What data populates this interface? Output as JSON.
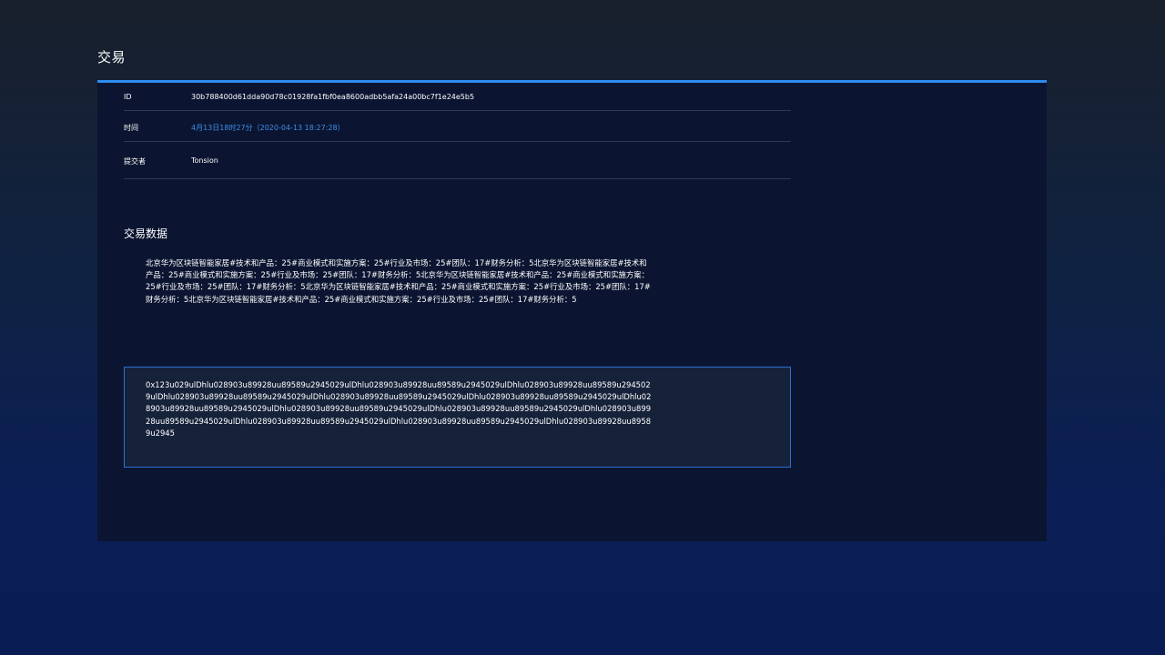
{
  "page": {
    "title": "交易"
  },
  "details": {
    "id_label": "ID",
    "id_value": "30b788400d61dda90d78c01928fa1fbf0ea8600adbb5afa24a00bc7f1e24e5b5",
    "time_label": "时间",
    "time_value": "4月13日18时27分（2020-04-13 18:27:28）",
    "submitter_label": "提交者",
    "submitter_value": "Tonsion"
  },
  "tx_data": {
    "title": "交易数据",
    "text": "北京华为区块链智能家居#技术和产品：25#商业模式和实施方案：25#行业及市场：25#团队：17#财务分析：5北京华为区块链智能家居#技术和产品：25#商业模式和实施方案：25#行业及市场：25#团队：17#财务分析：5北京华为区块链智能家居#技术和产品：25#商业模式和实施方案：25#行业及市场：25#团队：17#财务分析：5北京华为区块链智能家居#技术和产品：25#商业模式和实施方案：25#行业及市场：25#团队：17#财务分析：5北京华为区块链智能家居#技术和产品：25#商业模式和实施方案：25#行业及市场：25#团队：17#财务分析：5",
    "hex": "0x123u029ulDhlu028903u89928uu89589u2945029ulDhlu028903u89928uu89589u2945029ulDhlu028903u89928uu89589u2945029ulDhlu028903u89928uu89589u2945029ulDhlu028903u89928uu89589u2945029ulDhlu028903u89928uu89589u2945029ulDhlu028903u89928uu89589u2945029ulDhlu028903u89928uu89589u2945029ulDhlu028903u89928uu89589u2945029ulDhlu028903u89928uu89589u2945029ulDhlu028903u89928uu89589u2945029ulDhlu028903u89928uu89589u2945029ulDhlu028903u89928uu89589u2945"
  },
  "colors": {
    "accent": "#2d8bf0",
    "link": "#3f8fe8",
    "panel_bg": "#0b1531",
    "hex_box_bg": "#16223a"
  }
}
